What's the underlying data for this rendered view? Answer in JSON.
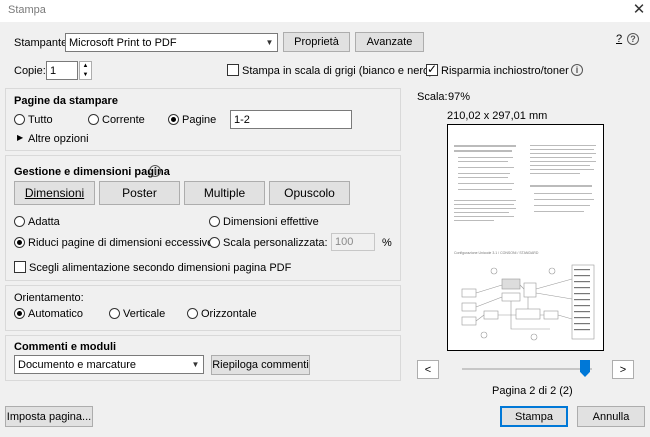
{
  "window": {
    "title": "Stampa",
    "close_glyph": "✕",
    "help_glyph": "?",
    "help_icon": "question-circle-icon"
  },
  "printer": {
    "label": "Stampante:",
    "selected": "Microsoft Print to PDF",
    "properties_label": "Proprietà",
    "advanced_label": "Avanzate"
  },
  "copies": {
    "label": "Copie:",
    "value": "1",
    "grayscale_label": "Stampa in scala di grigi (bianco e nero)",
    "grayscale_checked": false,
    "save_ink_label": "Risparmia inchiostro/toner",
    "save_ink_checked": true
  },
  "pages_to_print": {
    "title": "Pagine da stampare",
    "all_label": "Tutto",
    "current_label": "Corrente",
    "pages_label": "Pagine",
    "selected": "pages",
    "range_value": "1-2",
    "more_options_label": "Altre opzioni"
  },
  "page_handling": {
    "title": "Gestione e dimensioni pagina",
    "tabs": [
      "Dimensioni",
      "Poster",
      "Multiple",
      "Opuscolo"
    ],
    "fit_label": "Adatta",
    "actual_size_label": "Dimensioni effettive",
    "shrink_label": "Riduci pagine di dimensioni eccessive",
    "custom_scale_label": "Scala personalizzata:",
    "custom_scale_value": "100",
    "percent": "%",
    "selected": "shrink",
    "paper_source_label": "Scegli alimentazione secondo dimensioni pagina PDF",
    "paper_source_checked": false
  },
  "orientation": {
    "title": "Orientamento:",
    "auto_label": "Automatico",
    "portrait_label": "Verticale",
    "landscape_label": "Orizzontale",
    "selected": "auto"
  },
  "comments": {
    "title": "Commenti e moduli",
    "selected": "Documento e marcature",
    "summarize_label": "Riepiloga commenti"
  },
  "preview": {
    "scale_label": "Scala:",
    "scale_value": "97%",
    "size": "210,02 x 297,01 mm",
    "prev_glyph": "<",
    "next_glyph": ">",
    "page_status": "Pagina 2 di 2 (2)",
    "position_fraction": 1.0,
    "doc_heading": "Configurazione Unicode 3.1 / CONSONI / STANDARD"
  },
  "footer": {
    "page_setup_label": "Imposta pagina...",
    "print_label": "Stampa",
    "cancel_label": "Annulla"
  }
}
